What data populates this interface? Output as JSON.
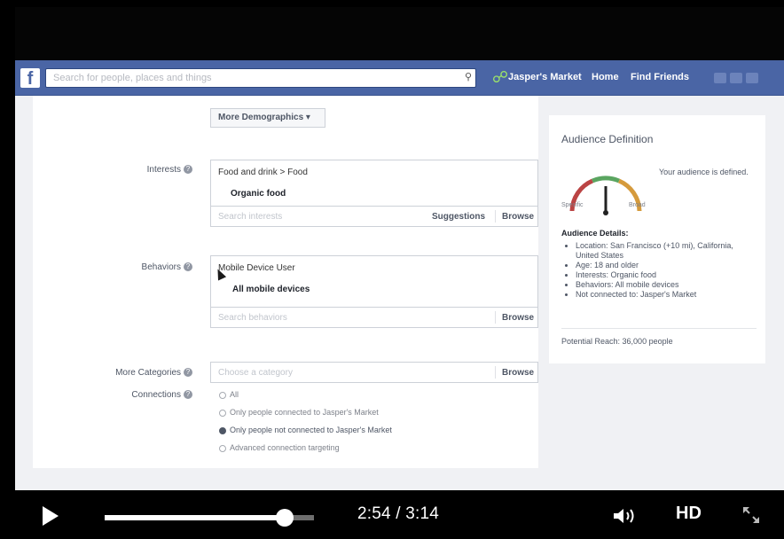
{
  "fb": {
    "logo": "f",
    "search_placeholder": "Search for people, places and things",
    "page_name": "Jasper's Market",
    "nav_home": "Home",
    "nav_find_friends": "Find Friends",
    "brand_color": "#4a65a5"
  },
  "form": {
    "more_demographics": "More Demographics ▾",
    "interests": {
      "label": "Interests",
      "path": "Food and drink > Food",
      "selected": "Organic food",
      "placeholder": "Search interests",
      "suggestions": "Suggestions",
      "browse": "Browse"
    },
    "behaviors": {
      "label": "Behaviors",
      "path": "Mobile Device User",
      "selected": "All mobile devices",
      "placeholder": "Search behaviors",
      "browse": "Browse"
    },
    "more_categories": {
      "label": "More Categories",
      "placeholder": "Choose a category",
      "browse": "Browse"
    },
    "connections": {
      "label": "Connections",
      "options": [
        {
          "label": "All",
          "selected": false
        },
        {
          "label": "Only people connected to Jasper's Market",
          "selected": false
        },
        {
          "label": "Only people not connected to Jasper's Market",
          "selected": true
        },
        {
          "label": "Advanced connection targeting",
          "selected": false
        }
      ]
    }
  },
  "audience": {
    "title": "Audience Definition",
    "message": "Your audience is defined.",
    "gauge_specific": "Specific",
    "gauge_broad": "Broad",
    "details_title": "Audience Details:",
    "details": [
      "Location: San Francisco (+10 mi), California, United States",
      "Age: 18 and older",
      "Interests: Organic food",
      "Behaviors: All mobile devices",
      "Not connected to: Jasper's Market"
    ],
    "reach": "Potential Reach: 36,000 people"
  },
  "player": {
    "current_time": "2:54",
    "duration": "3:14",
    "time_display": "2:54 / 3:14",
    "progress": 0.86,
    "quality": "HD",
    "icons": [
      "play-icon",
      "volume-icon",
      "fullscreen-icon"
    ]
  }
}
